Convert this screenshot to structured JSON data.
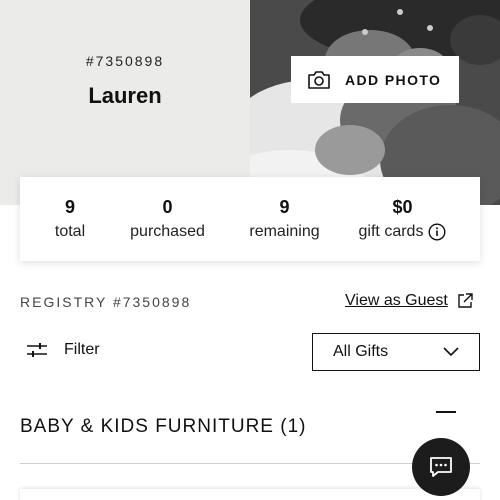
{
  "registry": {
    "number_display": "#7350898",
    "owner_name": "Lauren",
    "add_photo_label": "ADD PHOTO"
  },
  "stats": [
    {
      "value": "9",
      "label": "total"
    },
    {
      "value": "0",
      "label": "purchased"
    },
    {
      "value": "9",
      "label": "remaining"
    },
    {
      "value": "$0",
      "label": "gift cards"
    }
  ],
  "registry_bar": {
    "label": "REGISTRY #7350898",
    "view_as_guest": "View as Guest"
  },
  "filter": {
    "label": "Filter",
    "select_value": "All Gifts"
  },
  "category": {
    "title": "BABY & KIDS FURNITURE (1)"
  },
  "icons": {
    "camera": "camera-icon",
    "info": "info-icon",
    "external_link": "external-link-icon",
    "filter": "sliders-icon",
    "chevron": "chevron-down-icon",
    "collapse": "minus-icon",
    "chat": "chat-icon"
  },
  "colors": {
    "hero_bg": "#ebebe9",
    "chat_fab": "#1c1c1c",
    "text": "#111111"
  }
}
